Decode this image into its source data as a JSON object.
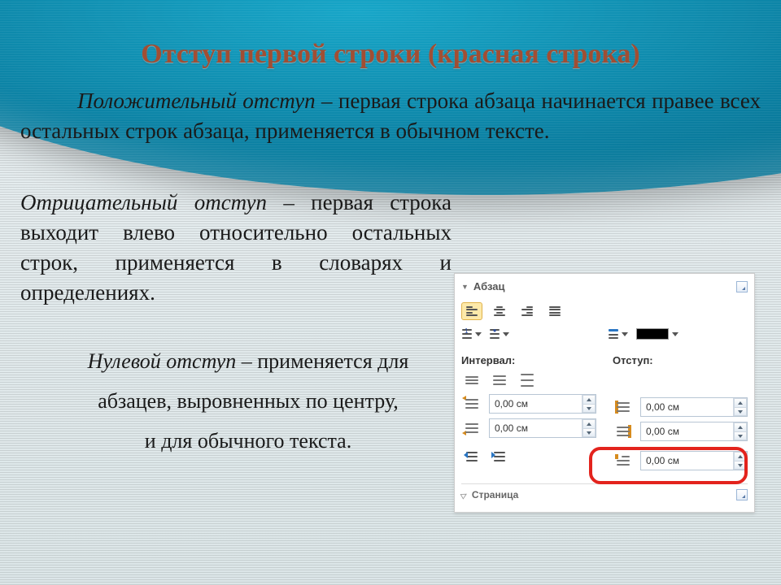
{
  "title": "Отступ первой строки (красная строка)",
  "p1": {
    "emph": "Положительный отступ",
    "rest": " – первая строка абзаца начинается правее всех остальных строк абзаца, применяется в обычном тексте."
  },
  "p2": {
    "emph": "Отрицательный отступ",
    "rest": " – первая строка выходит влево относительно остальных строк, применяется в словарях и определениях."
  },
  "p3": {
    "emph": "Нулевой отступ",
    "line1_rest": " – применяется для",
    "line2": "абзацев, выровненных по центру,",
    "line3": "и для обычного текста."
  },
  "panel": {
    "section_paragraph": "Абзац",
    "section_page": "Страница",
    "label_interval": "Интервал:",
    "label_indent": "Отступ:",
    "spacing_before": "0,00 см",
    "spacing_after": "0,00 см",
    "indent_left": "0,00 см",
    "indent_right": "0,00 см",
    "indent_first": "0,00 см"
  }
}
